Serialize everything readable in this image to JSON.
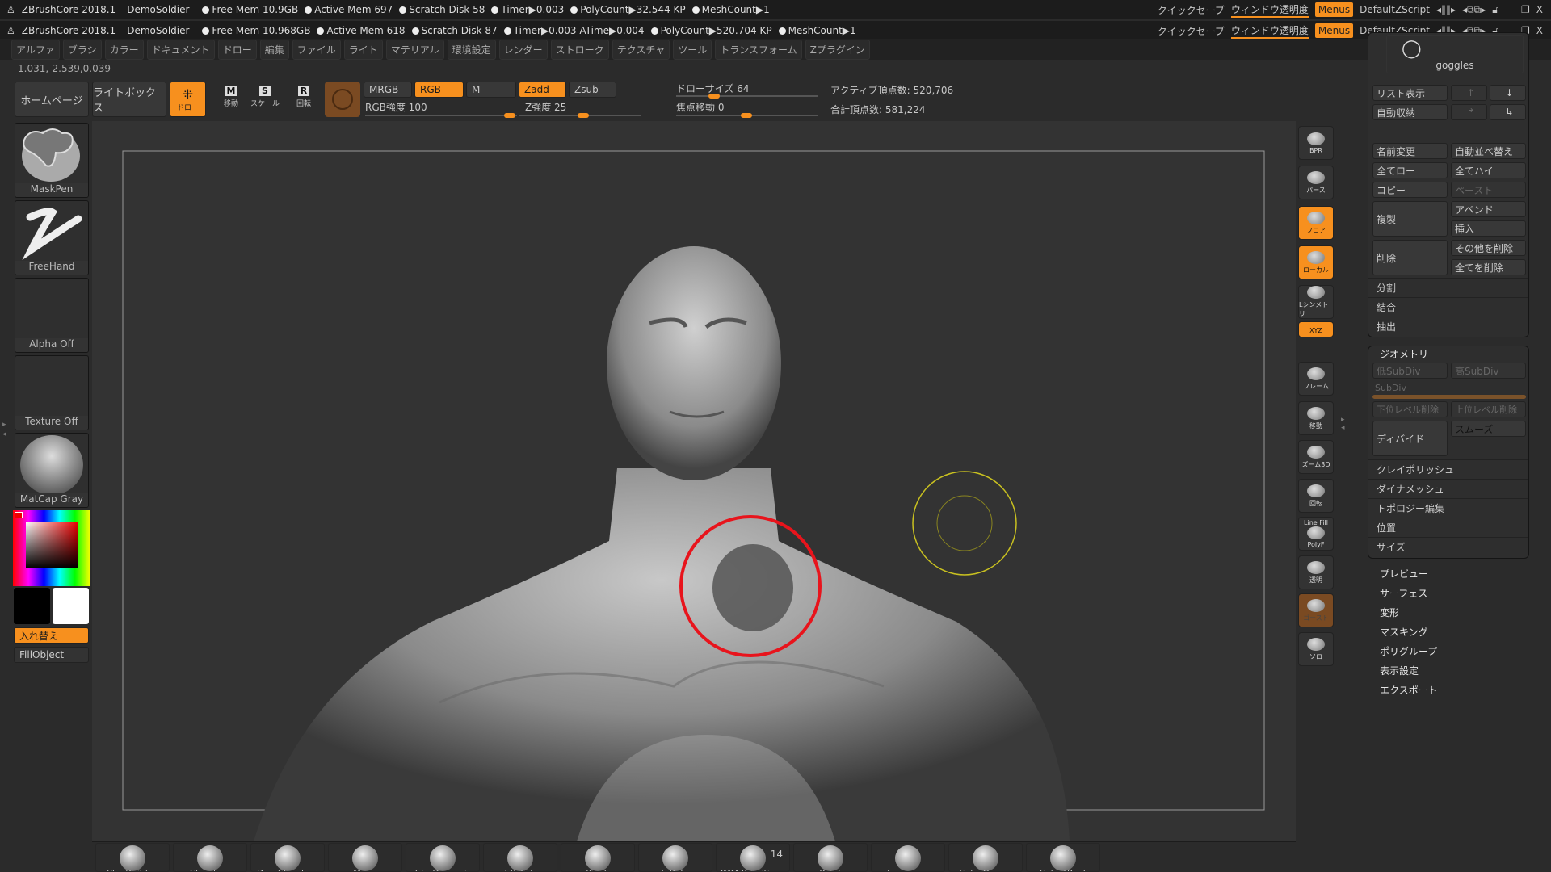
{
  "titlebar_rows": [
    {
      "app": "ZBrushCore 2018.1",
      "project": "DemoSoldier",
      "stats": [
        "Free Mem 10.9GB",
        "Active Mem 697",
        "Scratch Disk 58",
        "Timer▶0.003",
        "PolyCount▶32.544 KP",
        "MeshCount▶1"
      ]
    },
    {
      "app": "ZBrushCore 2018.1",
      "project": "DemoSoldier",
      "stats": [
        "Free Mem 10.968GB",
        "Active Mem 618",
        "Scratch Disk 87",
        "Timer▶0.003 ATime▶0.004",
        "PolyCount▶520.704 KP",
        "MeshCount▶1"
      ]
    }
  ],
  "titlebar_right": {
    "quicksave": "クイックセーブ",
    "transparency": "ウィンドウ透明度",
    "menus": "Menus",
    "script": "DefaultZScript",
    "minimize": "—",
    "restore": "❐",
    "close": "X"
  },
  "menubar": [
    "アルファ",
    "ブラシ",
    "カラー",
    "ドキュメント",
    "ドロー",
    "編集",
    "ファイル",
    "ライト",
    "マテリアル",
    "環境設定",
    "レンダー",
    "ストローク",
    "テクスチャ",
    "ツール",
    "トランスフォーム",
    "Zプラグイン"
  ],
  "coords": "1.031,-2.539,0.039",
  "toolbar": {
    "home": "ホームページ",
    "lightbox": "ライトボックス",
    "draw": "ドロー",
    "move": "移動",
    "scale": "スケール",
    "rotate": "回転",
    "move_key": "M",
    "scale_key": "S",
    "rotate_key": "R",
    "mrgb": "MRGB",
    "rgb": "RGB",
    "m": "M",
    "zadd": "Zadd",
    "zsub": "Zsub",
    "rgb_intensity": "RGB強度 100",
    "z_intensity": "Z強度 25",
    "draw_size": "ドローサイズ 64",
    "focal_shift": "焦点移動 0",
    "active_points": "アクティブ頂点数: 520,706",
    "total_points": "合計頂点数: 581,224",
    "rgb_intensity_value": 100,
    "z_intensity_value": 25,
    "draw_size_value": 64,
    "focal_shift_value": 0
  },
  "left_panel": {
    "brush": "MaskPen",
    "stroke": "FreeHand",
    "alpha": "Alpha Off",
    "texture": "Texture Off",
    "material": "MatCap Gray",
    "swap": "入れ替え",
    "fill": "FillObject",
    "main_color": "#000000",
    "secondary_color": "#ffffff"
  },
  "right_shelf": [
    {
      "label": "BPR",
      "icon": "bpr-icon"
    },
    {
      "label": "パース",
      "icon": "perspective-icon"
    },
    {
      "label": "フロア",
      "icon": "floor-icon",
      "active": true
    },
    {
      "label": "ローカル",
      "icon": "local-icon",
      "active": true
    },
    {
      "label": "Lシンメトリ",
      "icon": "symmetry-icon"
    },
    {
      "label": "XYZ",
      "icon": "xyz-rotate-icon",
      "active": true
    },
    {
      "label": "フレーム",
      "icon": "frame-icon"
    },
    {
      "label": "移動",
      "icon": "move-hand-icon"
    },
    {
      "label": "ズーム3D",
      "icon": "zoom3d-icon"
    },
    {
      "label": "回転",
      "icon": "rotate-icon"
    },
    {
      "label": "PolyF",
      "icon": "polyframe-icon",
      "top": "Line Fill"
    },
    {
      "label": "透明",
      "icon": "transparent-icon"
    },
    {
      "label": "ゴースト",
      "icon": "ghost-icon"
    },
    {
      "label": "ソロ",
      "icon": "solo-icon"
    }
  ],
  "subtool": {
    "name": "goggles",
    "list_view": "リスト表示",
    "auto_collapse": "自動収納",
    "rename": "名前変更",
    "auto_reorder": "自動並べ替え",
    "all_low": "全てロー",
    "all_high": "全てハイ",
    "copy": "コピー",
    "paste": "ペースト",
    "duplicate": "複製",
    "append": "アペンド",
    "insert": "挿入",
    "delete": "削除",
    "delete_other": "その他を削除",
    "delete_all": "全てを削除",
    "split": "分割",
    "merge": "結合",
    "extract": "抽出"
  },
  "geometry": {
    "title": "ジオメトリ",
    "lower_subdiv": "低SubDiv",
    "higher_subdiv": "高SubDiv",
    "subdiv": "SubDiv",
    "del_lower": "下位レベル削除",
    "del_higher": "上位レベル削除",
    "divide": "ディバイド",
    "smooth": "スムーズ",
    "rows": [
      "クレイポリッシュ",
      "ダイナメッシュ",
      "トポロジー編集",
      "位置",
      "サイズ"
    ]
  },
  "tool_sections": [
    "プレビュー",
    "サーフェス",
    "変形",
    "マスキング",
    "ポリグループ",
    "表示設定",
    "エクスポート"
  ],
  "brushes": [
    "ClayBuildup",
    "Standard",
    "DamStandard",
    "Move",
    "TrimDynamic",
    "hPolish",
    "Pinch",
    "Inflate",
    "IMM Primitives",
    "Paint",
    "Transpose",
    "SelectLasso",
    "SelectRect"
  ],
  "imm_count": "14",
  "colors": {
    "accent": "#f7901e",
    "brush_cursor": "#e8141c",
    "focal_ring": "#c8c020"
  }
}
